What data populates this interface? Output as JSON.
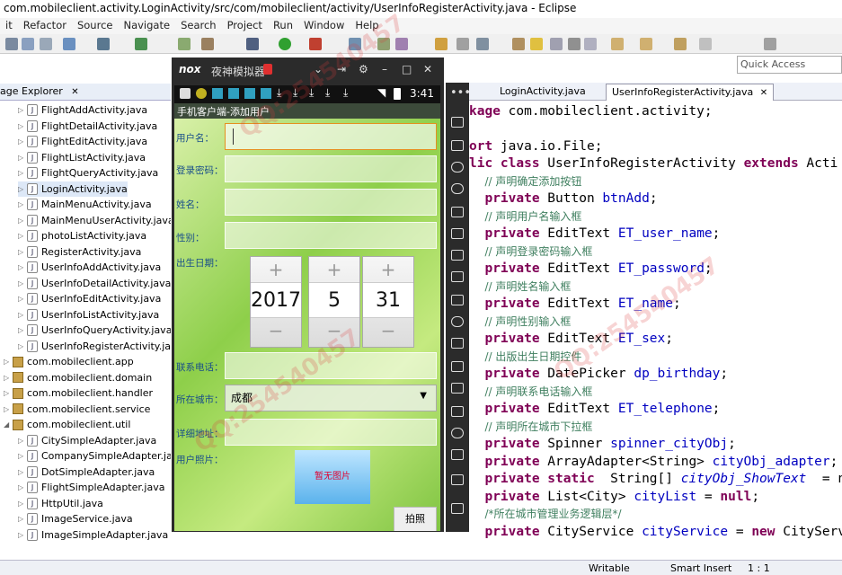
{
  "window": {
    "title": "com.mobileclient.activity.LoginActivity/src/com/mobileclient/activity/UserInfoRegisterActivity.java - Eclipse"
  },
  "menu": [
    "it",
    "Refactor",
    "Source",
    "Navigate",
    "Search",
    "Project",
    "Run",
    "Window",
    "Help"
  ],
  "quick_access": "Quick Access",
  "package_explorer": {
    "title": "age Explorer",
    "items": [
      {
        "label": "FlightAddActivity.java",
        "type": "file"
      },
      {
        "label": "FlightDetailActivity.java",
        "type": "file"
      },
      {
        "label": "FlightEditActivity.java",
        "type": "file"
      },
      {
        "label": "FlightListActivity.java",
        "type": "file"
      },
      {
        "label": "FlightQueryActivity.java",
        "type": "file"
      },
      {
        "label": "LoginActivity.java",
        "type": "file"
      },
      {
        "label": "MainMenuActivity.java",
        "type": "file"
      },
      {
        "label": "MainMenuUserActivity.java",
        "type": "file"
      },
      {
        "label": "photoListActivity.java",
        "type": "file"
      },
      {
        "label": "RegisterActivity.java",
        "type": "file"
      },
      {
        "label": "UserInfoAddActivity.java",
        "type": "file"
      },
      {
        "label": "UserInfoDetailActivity.java",
        "type": "file"
      },
      {
        "label": "UserInfoEditActivity.java",
        "type": "file"
      },
      {
        "label": "UserInfoListActivity.java",
        "type": "file"
      },
      {
        "label": "UserInfoQueryActivity.java",
        "type": "file"
      },
      {
        "label": "UserInfoRegisterActivity.java",
        "type": "file"
      },
      {
        "label": "com.mobileclient.app",
        "type": "pkg"
      },
      {
        "label": "com.mobileclient.domain",
        "type": "pkg"
      },
      {
        "label": "com.mobileclient.handler",
        "type": "pkg"
      },
      {
        "label": "com.mobileclient.service",
        "type": "pkg"
      },
      {
        "label": "com.mobileclient.util",
        "type": "pkg"
      },
      {
        "label": "CitySimpleAdapter.java",
        "type": "file"
      },
      {
        "label": "CompanySimpleAdapter.java",
        "type": "file"
      },
      {
        "label": "DotSimpleAdapter.java",
        "type": "file"
      },
      {
        "label": "FlightSimpleAdapter.java",
        "type": "file"
      },
      {
        "label": "HttpUtil.java",
        "type": "file"
      },
      {
        "label": "ImageService.java",
        "type": "file"
      },
      {
        "label": "ImageSimpleAdapter.java",
        "type": "file"
      }
    ]
  },
  "emulator": {
    "title": "夜神模拟器",
    "time": "3:41",
    "app_title": "手机客户端-添加用户",
    "labels": {
      "username": "用户名：",
      "password": "登录密码：",
      "name": "姓名：",
      "sex": "性别：",
      "birthday": "出生日期：",
      "telephone": "联系电话：",
      "city": "所在城市：",
      "address": "详细地址：",
      "photo": "用户照片："
    },
    "date": {
      "year": "2017",
      "month": "5",
      "day": "31"
    },
    "city_selected": "成都",
    "photo_placeholder": "暂无图片",
    "photo_button": "拍照"
  },
  "editor": {
    "tabs": [
      "LoginActivity.java",
      "UserInfoRegisterActivity.java"
    ]
  },
  "statusbar": {
    "mode": "Writable",
    "insert": "Smart Insert",
    "pos": "1 : 1"
  },
  "watermark": "QQ:254540457"
}
